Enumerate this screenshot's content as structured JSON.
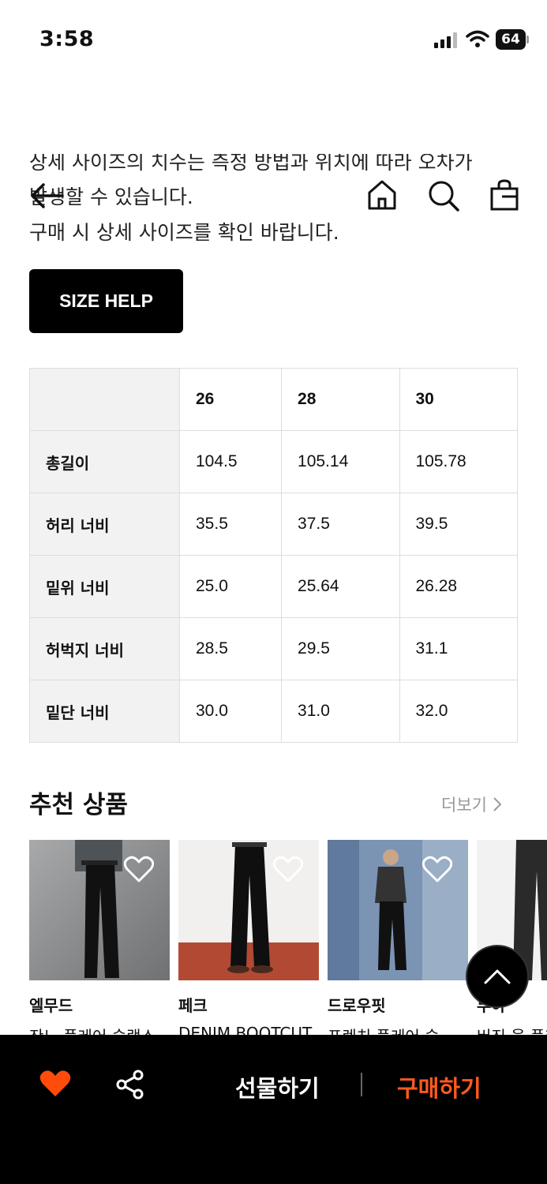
{
  "status_bar": {
    "time": "3:58",
    "battery": "64"
  },
  "nav": {
    "icons": [
      "back-arrow-icon",
      "home-icon",
      "search-icon",
      "shopping-bag-icon"
    ]
  },
  "intro": {
    "partial_line": "상세 사이즈의 치수는 측정 방법과 위치에 따라 오차가",
    "line1": "발생할 수 있습니다.",
    "line2": "구매 시 상세 사이즈를 확인 바랍니다."
  },
  "size_help_label": "SIZE HELP",
  "size_table": {
    "columns": [
      "",
      "26",
      "28",
      "30"
    ],
    "rows": [
      {
        "label": "총길이",
        "values": [
          "104.5",
          "105.14",
          "105.78"
        ]
      },
      {
        "label": "허리 너비",
        "values": [
          "35.5",
          "37.5",
          "39.5"
        ]
      },
      {
        "label": "밑위 너비",
        "values": [
          "25.0",
          "25.64",
          "26.28"
        ]
      },
      {
        "label": "허벅지 너비",
        "values": [
          "28.5",
          "29.5",
          "31.1"
        ]
      },
      {
        "label": "밑단 너비",
        "values": [
          "30.0",
          "31.0",
          "32.0"
        ]
      }
    ]
  },
  "recommended": {
    "title": "추천 상품",
    "more_label": "더보기",
    "products": [
      {
        "brand": "엘무드",
        "name": "잔느 플레어 슬랙스"
      },
      {
        "brand": "페크",
        "name": "DENIM BOOTCUT"
      },
      {
        "brand": "드로우핏",
        "name": "프렌치 플레어 슬랙스"
      },
      {
        "brand": "무아",
        "name": "버진 울 플레어"
      }
    ]
  },
  "bottom_bar": {
    "gift_label": "선물하기",
    "buy_label": "구매하기"
  },
  "colors": {
    "accent": "#ff5a1f",
    "heart": "#ff4c0a",
    "bar_bg": "#000000"
  }
}
